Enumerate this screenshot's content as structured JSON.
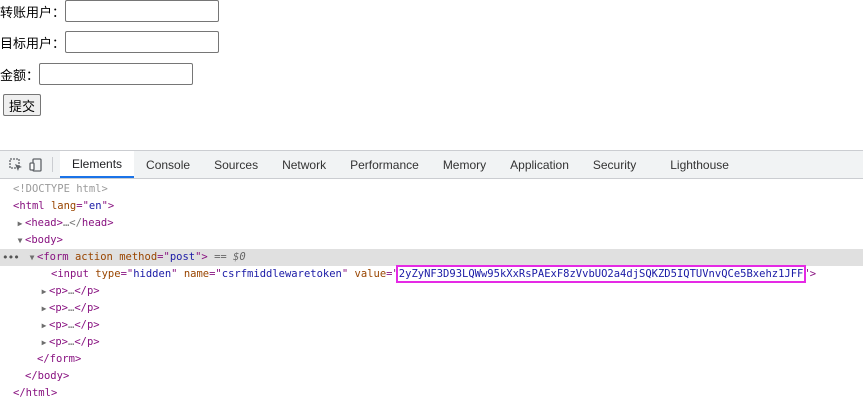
{
  "form": {
    "from_user_label": "转账用户：",
    "from_user_value": "",
    "to_user_label": "目标用户：",
    "to_user_value": "",
    "amount_label": "金额：",
    "amount_value": "",
    "submit_label": "提交"
  },
  "devtools": {
    "tabs": [
      "Elements",
      "Console",
      "Sources",
      "Network",
      "Performance",
      "Memory",
      "Application",
      "Security",
      "Lighthouse"
    ],
    "active_tab": "Elements",
    "tree": {
      "doctype": "<!DOCTYPE html>",
      "html_open_tag": "html",
      "html_lang_attr": "lang",
      "html_lang_val": "en",
      "head_text": "head",
      "head_collapsed": "…</",
      "body_tag": "body",
      "form_tag": "form",
      "form_action_attr": "action",
      "form_method_attr": "method",
      "form_method_val": "post",
      "selected_marker": " == $0",
      "input_tag": "input",
      "input_type_attr": "type",
      "input_type_val": "hidden",
      "input_name_attr": "name",
      "input_name_val": "csrfmiddlewaretoken",
      "input_value_attr": "value",
      "csrf_token": "2yZyNF3D93LQWw95kXxRsPAExF8zVvbUO2a4djSQKZD5IQTUVnvQCe5Bxehz1JFF",
      "p_tag": "p",
      "p_collapsed": "…",
      "form_close": "form",
      "body_close": "body",
      "html_close": "html"
    },
    "highlight_color": "#e52ae5",
    "active_tab_color": "#1a73e8"
  }
}
